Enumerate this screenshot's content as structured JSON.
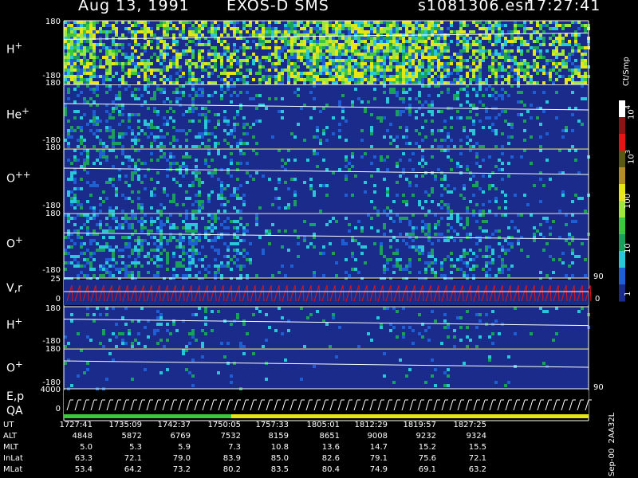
{
  "header": {
    "date": "Aug 13, 1991",
    "mission": "EXOS-D SMS",
    "file": "s1081306.esr",
    "time": "17:27:41"
  },
  "colorbar": {
    "unit": "Ct/Smp",
    "ticks": [
      "1",
      "10",
      "100",
      "10",
      "3",
      "10",
      "4"
    ],
    "tick_labels": [
      {
        "base": "1",
        "exp": ""
      },
      {
        "base": "10",
        "exp": ""
      },
      {
        "base": "100",
        "exp": ""
      },
      {
        "base": "10",
        "exp": "3"
      },
      {
        "base": "10",
        "exp": "4"
      }
    ],
    "colors": [
      "#1a2b8c",
      "#1e5fd6",
      "#28c8d8",
      "#1aa05a",
      "#3cc83c",
      "#9ee63c",
      "#e6e614",
      "#b48c28",
      "#5a5a14",
      "#e61414",
      "#8c1414",
      "#ffffff"
    ]
  },
  "chart_data": {
    "type": "heatmap",
    "title": "Aug 13, 1991   EXOS-D SMS",
    "panels": [
      {
        "label": "H",
        "charge": "+",
        "y_top": "180",
        "y_bottom": "-180",
        "kind": "pitch-angle spectrogram"
      },
      {
        "label": "He",
        "charge": "+",
        "y_top": "180",
        "y_bottom": "-180",
        "kind": "pitch-angle spectrogram"
      },
      {
        "label": "O",
        "charge": "++",
        "y_top": "180",
        "y_bottom": "-180",
        "kind": "pitch-angle spectrogram"
      },
      {
        "label": "O",
        "charge": "+",
        "y_top": "180",
        "y_bottom": "-180",
        "kind": "pitch-angle spectrogram"
      },
      {
        "label": "V,r",
        "charge": "",
        "y_top": "25",
        "y_bottom": "0",
        "right_top": "90",
        "right_bottom": "0",
        "kind": "line"
      },
      {
        "label": "H",
        "charge": "+",
        "y_top": "180",
        "y_bottom": "-180",
        "kind": "pitch-angle spectrogram"
      },
      {
        "label": "O",
        "charge": "+",
        "y_top": "180",
        "y_bottom": "-180",
        "kind": "pitch-angle spectrogram"
      },
      {
        "label": "E,p",
        "label2": "QA",
        "charge": "",
        "y_top": "4000",
        "y_bottom": "0",
        "right_top": "90",
        "kind": "sweep"
      }
    ],
    "x_ticks": [
      "1727:41",
      "1735:09",
      "1742:37",
      "1750:05",
      "1757:33",
      "1805:01",
      "1812:29",
      "1819:57",
      "1827:25"
    ]
  },
  "ephemeris": {
    "rows": [
      {
        "label": "UT",
        "values": [
          "1727:41",
          "1735:09",
          "1742:37",
          "1750:05",
          "1757:33",
          "1805:01",
          "1812:29",
          "1819:57",
          "1827:25"
        ]
      },
      {
        "label": "ALT",
        "values": [
          "4848",
          "5872",
          "6769",
          "7532",
          "8159",
          "8651",
          "9008",
          "9232",
          "9324"
        ]
      },
      {
        "label": "MLT",
        "values": [
          "5.0",
          "5.3",
          "5.9",
          "7.3",
          "10.8",
          "13.6",
          "14.7",
          "15.2",
          "15.5"
        ]
      },
      {
        "label": "InLat",
        "values": [
          "63.3",
          "72.1",
          "79.0",
          "83.9",
          "85.0",
          "82.6",
          "79.1",
          "75.6",
          "72.1"
        ]
      },
      {
        "label": "MLat",
        "values": [
          "53.4",
          "64.2",
          "73.2",
          "80.2",
          "83.5",
          "80.4",
          "74.9",
          "69.1",
          "63.2"
        ]
      }
    ]
  },
  "footer": {
    "version": "Sep-00",
    "code": "2AA32L"
  }
}
